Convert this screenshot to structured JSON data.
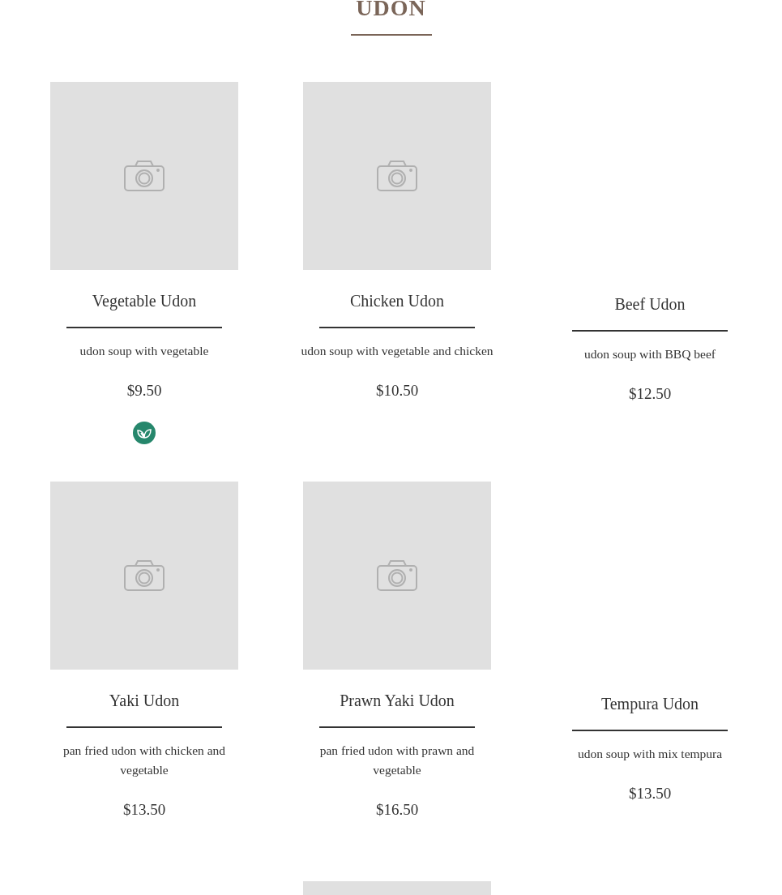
{
  "section_title": "UDON",
  "items": [
    {
      "has_image": true,
      "name": "Vegetable Udon",
      "description": "udon soup with vegetable",
      "price": "$9.50",
      "vegetarian": true
    },
    {
      "has_image": true,
      "name": "Chicken Udon",
      "description": "udon soup with vegetable and chicken",
      "price": "$10.50",
      "vegetarian": false
    },
    {
      "has_image": false,
      "name": "Beef Udon",
      "description": "udon soup with BBQ beef",
      "price": "$12.50",
      "vegetarian": false
    },
    {
      "has_image": true,
      "name": "Yaki Udon",
      "description": "pan fried udon with chicken and vegetable",
      "price": "$13.50",
      "vegetarian": false
    },
    {
      "has_image": true,
      "name": "Prawn Yaki Udon",
      "description": "pan fried udon with prawn and vegetable",
      "price": "$16.50",
      "vegetarian": false
    },
    {
      "has_image": false,
      "name": "Tempura Udon",
      "description": "udon soup with mix tempura",
      "price": "$13.50",
      "vegetarian": false
    },
    {
      "has_image": false
    },
    {
      "has_image": true
    }
  ]
}
